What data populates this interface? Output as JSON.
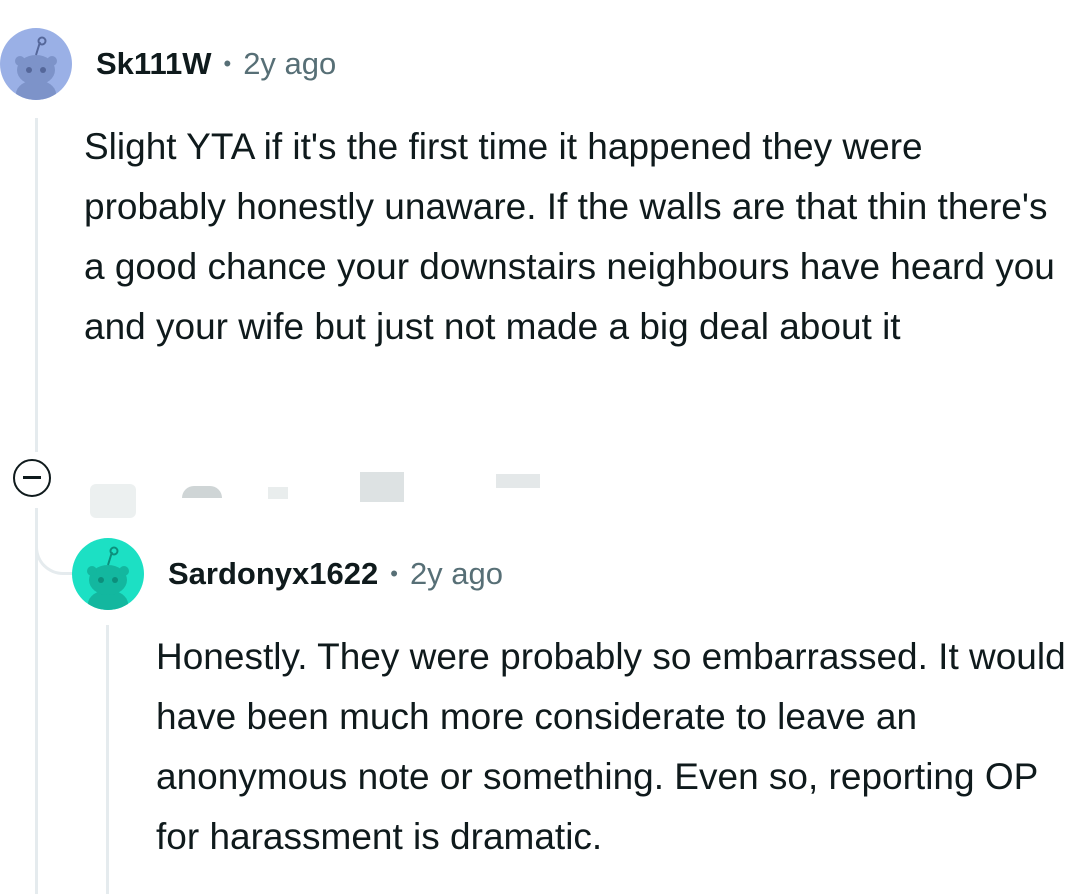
{
  "comments": [
    {
      "username": "Sk111W",
      "separator": "•",
      "time": "2y ago",
      "avatar_color": "#9ab0e6",
      "body": "Slight YTA if it's the first time it happened they were probably honestly unaware. If the walls are that thin there's a good chance your downstairs neighbours have heard you and your wife but just not made a big deal about it"
    },
    {
      "username": "Sardonyx1622",
      "separator": "•",
      "time": "2y ago",
      "avatar_color": "#1ce0c4",
      "body": "Honestly. They were probably so embarrassed. It would have been much more considerate to leave an anonymous note or something. Even so, reporting OP for harassment is dramatic."
    }
  ],
  "icons": {
    "collapse": "minus-circle-icon",
    "avatar": "reddit-snoo-icon"
  }
}
